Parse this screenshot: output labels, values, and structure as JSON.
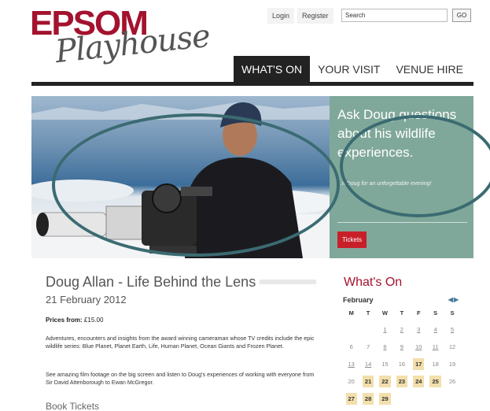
{
  "logo": {
    "line1": "EPSOM",
    "line2": "Playhouse"
  },
  "header": {
    "login": "Login",
    "register": "Register",
    "search_value": "Search",
    "search_button": "GO"
  },
  "nav": [
    {
      "label": "WHAT'S ON",
      "active": true
    },
    {
      "label": "YOUR VISIT",
      "active": false
    },
    {
      "label": "VENUE HIRE",
      "active": false
    }
  ],
  "hero": {
    "heading": "Ask Doug questions about his wildlife experiences.",
    "subtext": "...n Doug for an unforgettable evening!",
    "tickets_label": "Tickets",
    "panel_color": "#80a89a"
  },
  "event": {
    "title": "Doug Allan - Life Behind the Lens",
    "date": "21 February 2012",
    "prices_label": "Prices from:",
    "prices_value": "£15.00",
    "paragraph1": "Adventures, encounters and insights from the award winning cameraman whose TV credits include the epic wildlife series: Blue Planet, Planet Earth, Life, Human Planet, Ocean Giants and Frozen Planet.",
    "paragraph2": "See amazing film footage on the big screen and listen to Doug's experiences of working with everyone from Sir David Attenborough to Ewan McGregor.",
    "book_heading": "Book Tickets"
  },
  "calendar": {
    "heading": "What's On",
    "month": "February",
    "days": [
      "M",
      "T",
      "W",
      "T",
      "F",
      "S",
      "S"
    ],
    "weeks": [
      [
        {
          "d": ""
        },
        {
          "d": ""
        },
        {
          "d": "1",
          "s": "link"
        },
        {
          "d": "2",
          "s": "link"
        },
        {
          "d": "3",
          "s": "link"
        },
        {
          "d": "4",
          "s": "link"
        },
        {
          "d": "5",
          "s": "link"
        }
      ],
      [
        {
          "d": "6"
        },
        {
          "d": "7"
        },
        {
          "d": "8",
          "s": "link"
        },
        {
          "d": "9",
          "s": "link"
        },
        {
          "d": "10",
          "s": "link"
        },
        {
          "d": "11",
          "s": "link"
        },
        {
          "d": "12"
        }
      ],
      [
        {
          "d": "13",
          "s": "link"
        },
        {
          "d": "14",
          "s": "link"
        },
        {
          "d": "15"
        },
        {
          "d": "16"
        },
        {
          "d": "17",
          "s": "hl"
        },
        {
          "d": "18"
        },
        {
          "d": "19"
        }
      ],
      [
        {
          "d": "20"
        },
        {
          "d": "21",
          "s": "hl"
        },
        {
          "d": "22",
          "s": "hl"
        },
        {
          "d": "23",
          "s": "hl"
        },
        {
          "d": "24",
          "s": "hl"
        },
        {
          "d": "25",
          "s": "hl"
        },
        {
          "d": "26"
        }
      ],
      [
        {
          "d": "27",
          "s": "hl"
        },
        {
          "d": "28",
          "s": "hl"
        },
        {
          "d": "29",
          "s": "hl"
        },
        {
          "d": ""
        },
        {
          "d": ""
        },
        {
          "d": ""
        },
        {
          "d": ""
        }
      ]
    ]
  },
  "colors": {
    "brand_red": "#a3122e",
    "accent_teal": "#80a89a",
    "annotation": "#3b6b72",
    "highlight": "#f3dfac"
  }
}
